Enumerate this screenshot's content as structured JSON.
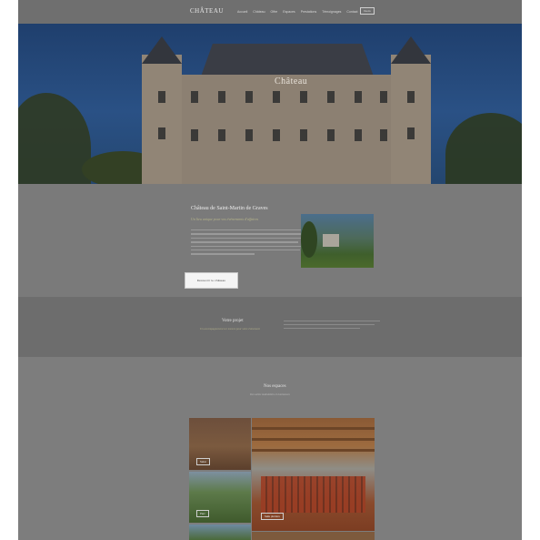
{
  "header": {
    "logo": "CHÂTEAU",
    "nav": [
      "Accueil",
      "Château",
      "Offre",
      "Espaces",
      "Prestations",
      "Témoignages",
      "Contact"
    ],
    "cta": "Devis"
  },
  "hero": {
    "title": "Château"
  },
  "intro": {
    "title": "Château de Saint-Martin de Graves",
    "subtitle": "Un lieu unique pour vos événements d'affaires",
    "button": "Découvrir le château"
  },
  "project": {
    "title": "Votre projet",
    "subtitle": "Un accompagnement sur mesure pour votre événement"
  },
  "spaces": {
    "title": "Nos espaces",
    "subtitle": "Des salles modulables et lumineuses",
    "tiles": [
      "Salon",
      "Salle plénière",
      "Parc"
    ]
  },
  "colors": {
    "accent": "#b7b58a",
    "overlay": "#7a7a7a"
  }
}
